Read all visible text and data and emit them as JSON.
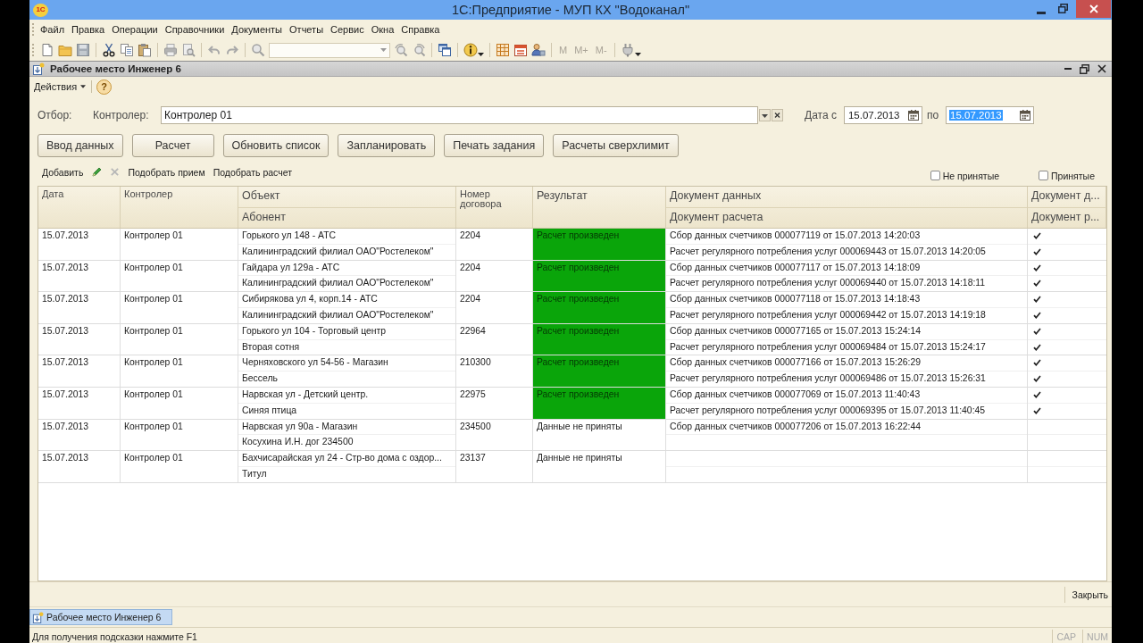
{
  "window": {
    "logo": "1С",
    "title": "1С:Предприятие - МУП КХ \"Водоканал\""
  },
  "menu": [
    "Файл",
    "Правка",
    "Операции",
    "Справочники",
    "Документы",
    "Отчеты",
    "Сервис",
    "Окна",
    "Справка"
  ],
  "toolbar": {
    "memory_buttons": [
      {
        "label": "M",
        "disabled": true
      },
      {
        "label": "M+",
        "disabled": true
      },
      {
        "label": "M-",
        "disabled": true
      }
    ]
  },
  "document_window": {
    "title": "Рабочее место Инженер 6"
  },
  "actions_bar": {
    "actions_menu": "Действия",
    "help": "?"
  },
  "filter": {
    "label": "Отбор:",
    "controller_label": "Контролер:",
    "controller_value": "Контролер 01",
    "dates": [
      {
        "label": "Дата с",
        "value": "15.07.2013",
        "text_selected": false
      },
      {
        "label": "по",
        "value": "15.07.2013",
        "text_selected": true
      }
    ]
  },
  "buttons": [
    "Ввод данных",
    "Расчет",
    "Обновить список",
    "Запланировать",
    "Печать задания",
    "Расчеты сверхлимит"
  ],
  "list_toolbar": {
    "add": "Добавить",
    "links": [
      "Подобрать прием",
      "Подобрать расчет"
    ],
    "checkboxes": [
      {
        "label": "Не принятые",
        "checked": false
      },
      {
        "label": "Принятые",
        "checked": false
      }
    ]
  },
  "table": {
    "columns": [
      {
        "top": "Дата",
        "kind": "small"
      },
      {
        "top": "Контролер",
        "kind": "small"
      },
      {
        "top": "Объект",
        "bottom": "Абонент",
        "kind": "large"
      },
      {
        "top": "Номер договора",
        "kind": "small"
      },
      {
        "top": "Результат",
        "kind": "large"
      },
      {
        "top": "Документ данных",
        "bottom": "Документ расчета",
        "kind": "large"
      },
      {
        "top": "Документ д...",
        "bottom": "Документ р...",
        "kind": "large"
      }
    ],
    "rows": [
      {
        "date": "15.07.2013",
        "controller": "Контролер 01",
        "object": "Горького ул 148 - АТС",
        "subscriber": "Калининградский филиал ОАО\"Ростелеком\"",
        "contract": "2204",
        "result": "Расчет произведен",
        "result_ok": true,
        "data_doc": "Сбор данных счетчиков 000077119 от 15.07.2013 14:20:03",
        "calc_doc": "Расчет регулярного потребления услуг 000069443 от 15.07.2013 14:20:05",
        "data_doc_posted": true,
        "calc_doc_posted": true
      },
      {
        "date": "15.07.2013",
        "controller": "Контролер 01",
        "object": "Гайдара ул 129а - АТС",
        "subscriber": "Калининградский филиал ОАО\"Ростелеком\"",
        "contract": "2204",
        "result": "Расчет произведен",
        "result_ok": true,
        "data_doc": "Сбор данных счетчиков 000077117 от 15.07.2013 14:18:09",
        "calc_doc": "Расчет регулярного потребления услуг 000069440 от 15.07.2013 14:18:11",
        "data_doc_posted": true,
        "calc_doc_posted": true
      },
      {
        "date": "15.07.2013",
        "controller": "Контролер 01",
        "object": "Сибирякова ул 4, корп.14 - АТС",
        "subscriber": "Калининградский филиал ОАО\"Ростелеком\"",
        "contract": "2204",
        "result": "Расчет произведен",
        "result_ok": true,
        "data_doc": "Сбор данных счетчиков 000077118 от 15.07.2013 14:18:43",
        "calc_doc": "Расчет регулярного потребления услуг 000069442 от 15.07.2013 14:19:18",
        "data_doc_posted": true,
        "calc_doc_posted": true
      },
      {
        "date": "15.07.2013",
        "controller": "Контролер 01",
        "object": "Горького ул 104 - Торговый центр",
        "subscriber": "Вторая сотня",
        "contract": "22964",
        "result": "Расчет произведен",
        "result_ok": true,
        "data_doc": "Сбор данных счетчиков 000077165 от 15.07.2013 15:24:14",
        "calc_doc": "Расчет регулярного потребления услуг 000069484 от 15.07.2013 15:24:17",
        "data_doc_posted": true,
        "calc_doc_posted": true
      },
      {
        "date": "15.07.2013",
        "controller": "Контролер 01",
        "object": "Черняховского ул 54-56 - Магазин",
        "subscriber": "Бессель",
        "contract": "210300",
        "result": "Расчет произведен",
        "result_ok": true,
        "data_doc": "Сбор данных счетчиков 000077166 от 15.07.2013 15:26:29",
        "calc_doc": "Расчет регулярного потребления услуг 000069486 от 15.07.2013 15:26:31",
        "data_doc_posted": true,
        "calc_doc_posted": true
      },
      {
        "date": "15.07.2013",
        "controller": "Контролер 01",
        "object": "Нарвская ул - Детский центр.",
        "subscriber": "Синяя птица",
        "contract": "22975",
        "result": "Расчет произведен",
        "result_ok": true,
        "data_doc": "Сбор данных счетчиков 000077069 от 15.07.2013 11:40:43",
        "calc_doc": "Расчет регулярного потребления услуг 000069395 от 15.07.2013 11:40:45",
        "data_doc_posted": true,
        "calc_doc_posted": true
      },
      {
        "date": "15.07.2013",
        "controller": "Контролер 01",
        "object": "Нарвская ул 90а - Магазин",
        "subscriber": "Косухина И.Н. дог 234500",
        "contract": "234500",
        "result": "Данные не приняты",
        "result_ok": false,
        "data_doc": "Сбор данных счетчиков 000077206 от 15.07.2013 16:22:44",
        "data_doc_posted": false,
        "calc_doc_posted": false
      },
      {
        "date": "15.07.2013",
        "controller": "Контролер 01",
        "object": "Бахчисарайская ул 24 - Стр-во дома с оздор...",
        "subscriber": "Титул",
        "contract": "23137",
        "result": "Данные не приняты",
        "result_ok": false,
        "data_doc_posted": false,
        "calc_doc_posted": false
      }
    ]
  },
  "footer": {
    "close": "Закрыть"
  },
  "taskbar": [
    {
      "label": "Рабочее место Инженер 6",
      "selected": true
    }
  ],
  "status_bar": {
    "hint": "Для получения подсказки нажмите F1",
    "indicators": [
      "CAP",
      "NUM"
    ]
  }
}
